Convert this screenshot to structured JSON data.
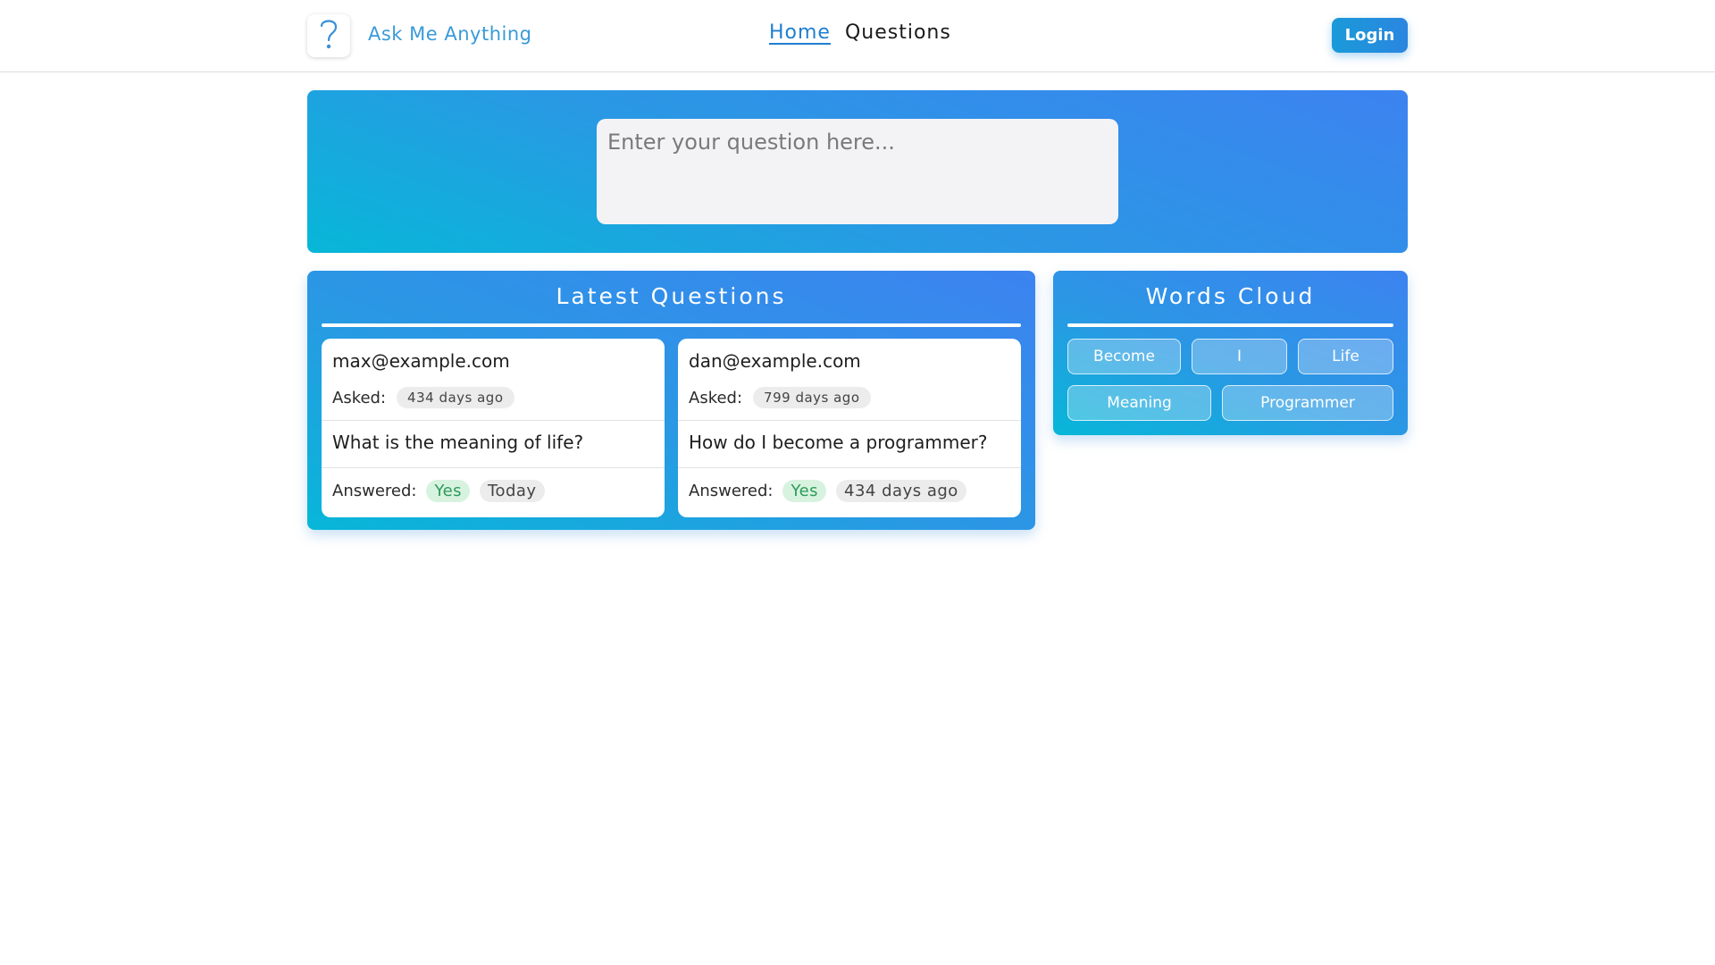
{
  "header": {
    "brand": "Ask Me Anything",
    "logo_icon": "question-mark-icon",
    "nav": {
      "home": "Home",
      "questions": "Questions"
    },
    "login": "Login",
    "accent_color": "#1f7fd1"
  },
  "hero": {
    "input_placeholder": "Enter your question here...",
    "input_value": ""
  },
  "latest": {
    "title": "Latest Questions",
    "questions": [
      {
        "email": "max@example.com",
        "asked_label": "Asked:",
        "asked": "434 days ago",
        "question": "What is the meaning of life?",
        "answered_label": "Answered:",
        "answered": "Yes",
        "answered_when": "Today"
      },
      {
        "email": "dan@example.com",
        "asked_label": "Asked:",
        "asked": "799 days ago",
        "question": "How do I become a programmer?",
        "answered_label": "Answered:",
        "answered": "Yes",
        "answered_when": "434 days ago"
      }
    ]
  },
  "words": {
    "title": "Words Cloud",
    "items": [
      "Become",
      "I",
      "Life",
      "Meaning",
      "Programmer"
    ]
  },
  "colors": {
    "gradient_start": "#07b7d8",
    "gradient_end": "#3c83f0",
    "answered_yes": "#2e9b59"
  }
}
